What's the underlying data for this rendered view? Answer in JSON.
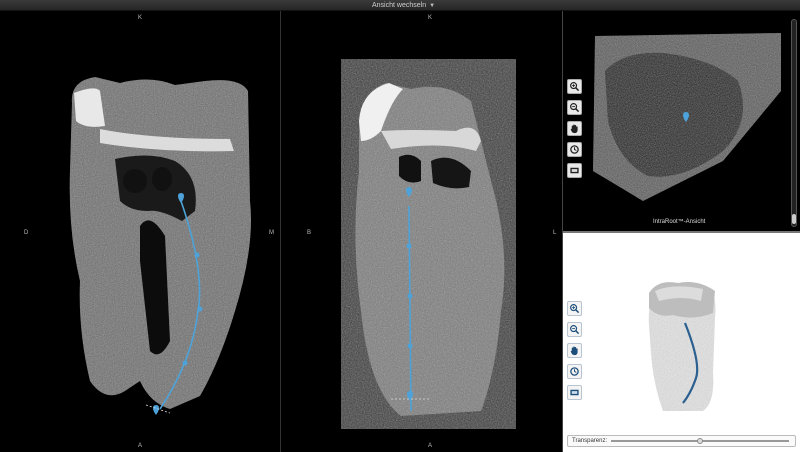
{
  "topbar": {
    "view_switch_label": "Ansicht wechseln"
  },
  "pane_left": {
    "orientation": {
      "top": "K",
      "bottom": "A",
      "left": "D",
      "right": "M"
    }
  },
  "pane_middle": {
    "orientation": {
      "top": "K",
      "bottom": "A",
      "left": "B",
      "right": "L"
    }
  },
  "pane_intraroot": {
    "caption": "IntraRoot™-Ansicht",
    "tools": [
      "zoom-in",
      "zoom-out",
      "pan",
      "rotate",
      "reset"
    ],
    "scroll_position": 1.0
  },
  "pane_3d": {
    "tools": [
      "zoom-in",
      "zoom-out",
      "pan",
      "rotate",
      "reset"
    ],
    "transparency_label": "Transparenz:",
    "transparency_value": 0.5
  },
  "colors": {
    "canal_line": "#4da3d9",
    "background": "#000000",
    "panel_white": "#ffffff"
  }
}
